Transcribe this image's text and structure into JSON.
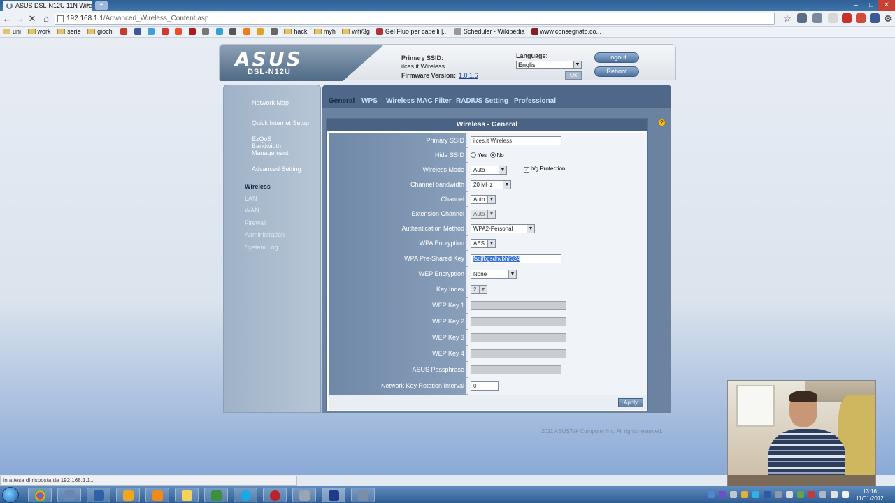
{
  "browser": {
    "tab_title": "ASUS DSL-N12U 11N Wirele",
    "tab_close": "×",
    "new_tab": "+",
    "url_host": "192.168.1.1",
    "url_path": "/Advanced_Wireless_Content.asp",
    "status_text": "In attesa di risposta da 192.168.1.1...",
    "bookmarks": [
      "uni",
      "work",
      "serie",
      "giochi",
      "hack",
      "myh",
      "wifi/3g",
      "Gel Fluo per capelli |...",
      "Scheduler - Wikipedia",
      "www.consegnato.co..."
    ]
  },
  "header": {
    "logo": "ASUS",
    "model": "DSL-N12U",
    "ssid_label": "Primary SSID:",
    "ssid_value": "ilces.it Wireless",
    "firmware_label": "Firmware Version:",
    "firmware_value": "1.0.1.6",
    "language_label": "Language:",
    "language_value": "English",
    "language_ok": "Ok",
    "logout": "Logout",
    "reboot": "Reboot"
  },
  "sidebar": {
    "network_map": "Network Map",
    "quick_setup": "Quick Internet Setup",
    "eze_qos": "EzQoS Bandwidth Management",
    "advanced": "Advanced Setting",
    "section": "Wireless",
    "links": [
      "LAN",
      "WAN",
      "Firewall",
      "Administration",
      "System Log"
    ]
  },
  "tabs": [
    "General",
    "WPS",
    "Wireless MAC Filter",
    "RADIUS Setting",
    "Professional"
  ],
  "panel": {
    "title": "Wireless - General",
    "help": "?",
    "rows": {
      "primary_ssid": {
        "label": "Primary SSID",
        "value": "ilces.it Wireless"
      },
      "hide_ssid": {
        "label": "Hide SSID",
        "yes": "Yes",
        "no": "No"
      },
      "wireless_mode": {
        "label": "Wireless Mode",
        "value": "Auto",
        "protection": "b/g Protection"
      },
      "channel_bandwidth": {
        "label": "Channel bandwidth",
        "value": "20 MHz"
      },
      "channel": {
        "label": "Channel",
        "value": "Auto"
      },
      "extension_channel": {
        "label": "Extension Channel",
        "value": "Auto"
      },
      "auth_method": {
        "label": "Authentication Method",
        "value": "WPA2-Personal"
      },
      "wpa_encryption": {
        "label": "WPA Encryption",
        "value": "AES"
      },
      "wpa_psk": {
        "label": "WPA Pre-Shared Key",
        "value": "fsdjfbgsdhvbhjf324"
      },
      "wep_encryption": {
        "label": "WEP Encryption",
        "value": "None"
      },
      "key_index": {
        "label": "Key Index",
        "value": "2"
      },
      "wep_key_1": {
        "label": "WEP Key 1"
      },
      "wep_key_2": {
        "label": "WEP Key 2"
      },
      "wep_key_3": {
        "label": "WEP Key 3"
      },
      "wep_key_4": {
        "label": "WEP Key 4"
      },
      "passphrase": {
        "label": "ASUS Passphrase"
      },
      "rotation": {
        "label": "Network Key Rotation Interval",
        "value": "0"
      }
    },
    "apply": "Apply"
  },
  "footer": {
    "copyright": "2011 ASUSTek Computer Inc. All rights reserved."
  },
  "taskbar": {
    "time": "13:16",
    "date": "11/01/2012"
  }
}
